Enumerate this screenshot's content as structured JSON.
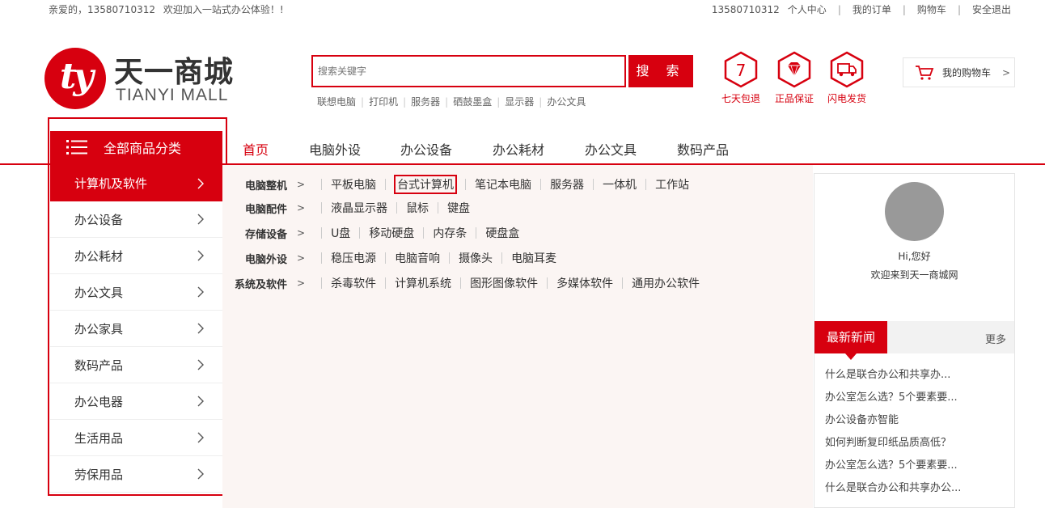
{
  "topbar": {
    "greeting": "亲爱的，13580710312",
    "welcome": "欢迎加入一站式办公体验！!",
    "phone": "13580710312",
    "links": [
      "个人中心",
      "我的订单",
      "购物车",
      "安全退出"
    ]
  },
  "logo": {
    "mark": "ty",
    "name_cn": "天一商城",
    "name_en": "TIANYI MALL"
  },
  "search": {
    "placeholder": "搜索关键字",
    "button": "搜 索",
    "hot_words": [
      "联想电脑",
      "打印机",
      "服务器",
      "硒鼓墨盒",
      "显示器",
      "办公文具"
    ]
  },
  "services": [
    {
      "label": "七天包退",
      "icon": "seven-hexagon-icon",
      "glyph": "7"
    },
    {
      "label": "正品保证",
      "icon": "diamond-hexagon-icon",
      "glyph": ""
    },
    {
      "label": "闪电发货",
      "icon": "truck-hexagon-icon",
      "glyph": ""
    }
  ],
  "cart": {
    "label": "我的购物车",
    "arrow": ">"
  },
  "nav": {
    "all_categories": "全部商品分类",
    "items": [
      "首页",
      "电脑外设",
      "办公设备",
      "办公耗材",
      "办公文具",
      "数码产品"
    ]
  },
  "categories": [
    "计算机及软件",
    "办公设备",
    "办公耗材",
    "办公文具",
    "办公家具",
    "数码产品",
    "办公电器",
    "生活用品",
    "劳保用品"
  ],
  "dropdown": [
    {
      "title": "电脑整机",
      "items": [
        "平板电脑",
        "台式计算机",
        "笔记本电脑",
        "服务器",
        "一体机",
        "工作站"
      ]
    },
    {
      "title": "电脑配件",
      "items": [
        "液晶显示器",
        "鼠标",
        "键盘"
      ]
    },
    {
      "title": "存储设备",
      "items": [
        "U盘",
        "移动硬盘",
        "内存条",
        "硬盘盒"
      ]
    },
    {
      "title": "电脑外设",
      "items": [
        "稳压电源",
        "电脑音响",
        "摄像头",
        "电脑耳麦"
      ]
    },
    {
      "title": "系统及软件",
      "items": [
        "杀毒软件",
        "计算机系统",
        "图形图像软件",
        "多媒体软件",
        "通用办公软件"
      ]
    }
  ],
  "user_panel": {
    "hi": "Hi,您好",
    "welcome": "欢迎来到天一商城网"
  },
  "news": {
    "title": "最新新闻",
    "more": "更多",
    "items": [
      "什么是联合办公和共享办...",
      "办公室怎么选？5个要素要...",
      "办公设备亦智能",
      "如何判断复印纸品质高低？",
      "办公室怎么选？5个要素要...",
      "什么是联合办公和共享办公..."
    ]
  },
  "colors": {
    "brand_red": "#d7000f",
    "avatar_gray": "#999999",
    "dropdown_bg": "#fbf5f3"
  }
}
